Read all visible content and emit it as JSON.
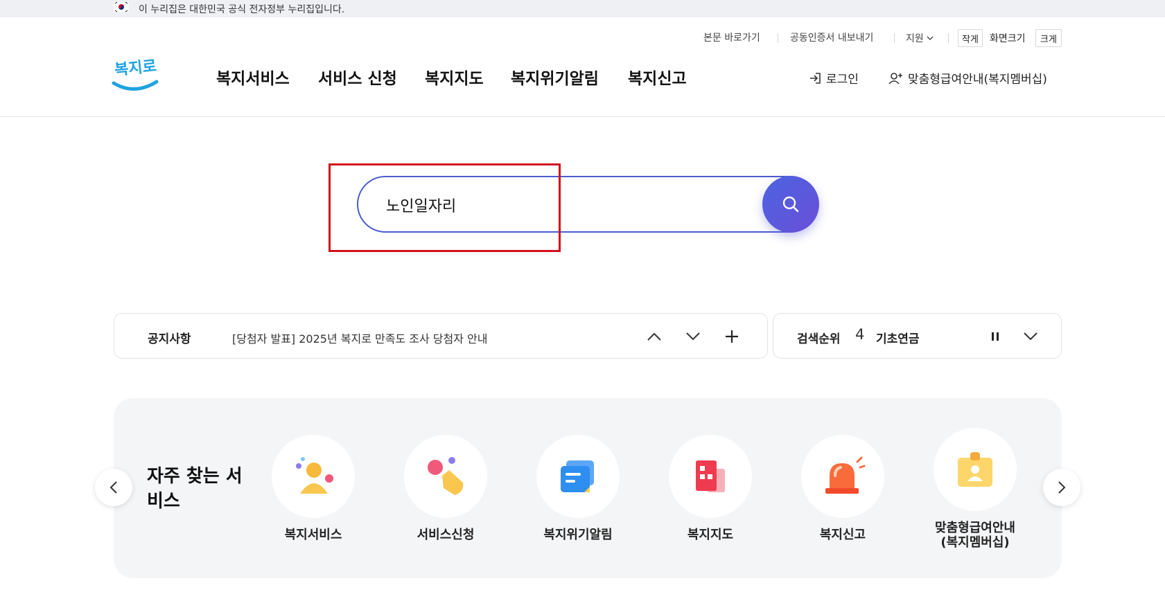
{
  "gov_banner": {
    "text": "이 누리집은 대한민국 공식 전자정부 누리집입니다."
  },
  "utility": {
    "skip_link": "본문 바로가기",
    "cert_export": "공동인증서 내보내기",
    "support": "지원",
    "font_small": "작게",
    "font_label": "화면크기",
    "font_large": "크게"
  },
  "logo": {
    "text": "복지로"
  },
  "gnb": {
    "items": [
      "복지서비스",
      "서비스 신청",
      "복지지도",
      "복지위기알림",
      "복지신고"
    ]
  },
  "header_links": {
    "login": "로그인",
    "member": "맞춤형급여안내(복지멤버십)"
  },
  "search": {
    "value": "노인일자리"
  },
  "notice": {
    "title": "공지사항",
    "text": "[당첨자 발표] 2025년 복지로 만족도 조사 당첨자 안내"
  },
  "ranking": {
    "title": "검색순위",
    "number": "4",
    "term": "기초연금"
  },
  "frequent": {
    "title": "자주 찾는 서비스",
    "services": [
      {
        "label": "복지서비스",
        "icon": "people-icon"
      },
      {
        "label": "서비스신청",
        "icon": "hand-click-icon"
      },
      {
        "label": "복지위기알림",
        "icon": "message-icon"
      },
      {
        "label": "복지지도",
        "icon": "map-icon"
      },
      {
        "label": "복지신고",
        "icon": "siren-icon"
      },
      {
        "label": "맞춤형급여안내\n(복지멤버십)",
        "icon": "id-card-icon"
      }
    ]
  },
  "colors": {
    "accent": "#4a5bd0",
    "highlight": "#d0101c",
    "logo_blue": "#1fa3e0"
  }
}
